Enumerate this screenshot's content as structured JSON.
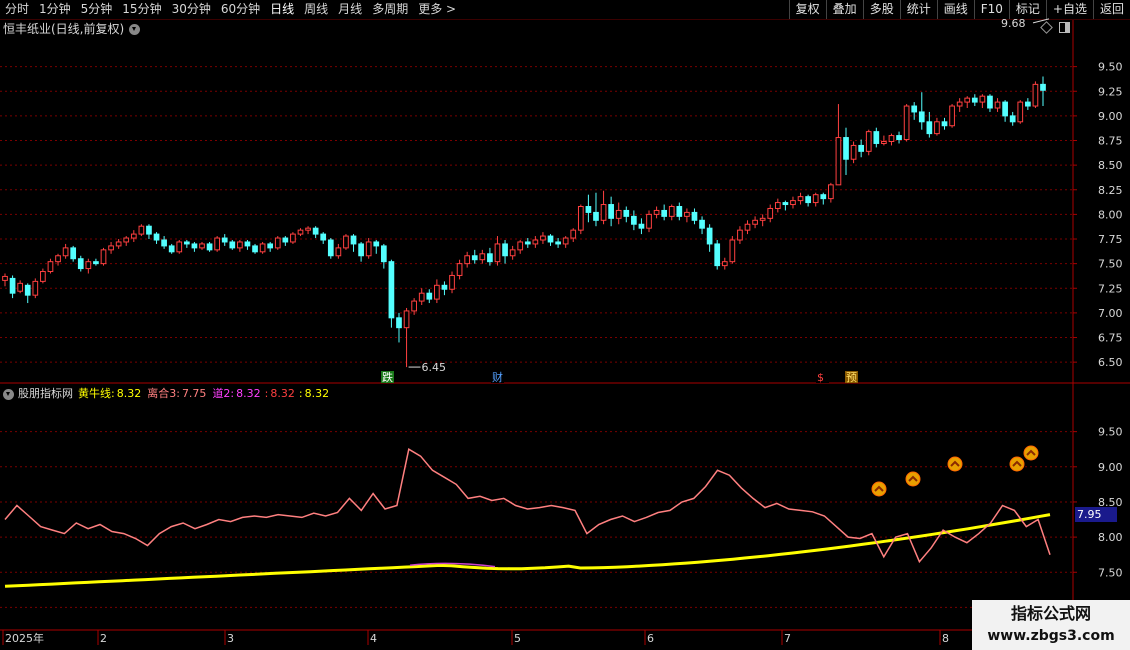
{
  "toolbar": {
    "periods": [
      "分时",
      "1分钟",
      "5分钟",
      "15分钟",
      "30分钟",
      "60分钟",
      "日线",
      "周线",
      "月线",
      "多周期",
      "更多 >"
    ],
    "active_period": "日线",
    "actions": [
      "复权",
      "叠加",
      "多股",
      "统计",
      "画线",
      "F10",
      "标记",
      "+自选",
      "返回"
    ]
  },
  "stock": {
    "title": "恒丰纸业(日线,前复权)",
    "high_label": "9.68",
    "low_label": "6.45"
  },
  "indicator": {
    "source": "股朋指标网",
    "l1_name": "黄牛线:",
    "l1_value": "8.32",
    "l2_name": "离合3:",
    "l2_value": "7.75",
    "l3_name": "道2:",
    "l3_value": "8.32",
    "l4_name": ":",
    "l4_value": "8.32",
    "l5_name": ":",
    "l5_value": "8.32",
    "current_badge": "7.95"
  },
  "markers": {
    "fall": "跌",
    "fin": "财",
    "dollar": "$",
    "pre": "预"
  },
  "axes": {
    "price_ticks": [
      "9.50",
      "9.25",
      "9.00",
      "8.75",
      "8.50",
      "8.25",
      "8.00",
      "7.75",
      "7.50",
      "7.25",
      "7.00",
      "6.75",
      "6.50"
    ],
    "ind_ticks": [
      "9.50",
      "9.00",
      "8.50",
      "8.00",
      "7.50",
      "7.00"
    ],
    "time_labels": [
      "2025年",
      "2",
      "3",
      "4",
      "5",
      "6",
      "7",
      "8"
    ]
  },
  "colors": {
    "up": "#ff4040",
    "down": "#54ffff",
    "yellow_line": "#ffff00",
    "pink_line": "#ff8080",
    "grid": "#7a0000"
  },
  "watermark": {
    "line1": "指标公式网",
    "line2": "www.zbgs3.com"
  },
  "chart_data": {
    "type": "candlestick",
    "title": "恒丰纸业(日线,前复权)",
    "price_range": [
      6.4,
      9.75
    ],
    "price_high": 9.68,
    "price_low": 6.45,
    "candles": [
      [
        7.33,
        7.37,
        7.27,
        7.4
      ],
      [
        7.35,
        7.2,
        7.15,
        7.38
      ],
      [
        7.22,
        7.3,
        7.2,
        7.33
      ],
      [
        7.28,
        7.18,
        7.1,
        7.3
      ],
      [
        7.18,
        7.32,
        7.15,
        7.35
      ],
      [
        7.32,
        7.42,
        7.3,
        7.45
      ],
      [
        7.42,
        7.52,
        7.4,
        7.55
      ],
      [
        7.52,
        7.58,
        7.48,
        7.6
      ],
      [
        7.58,
        7.66,
        7.55,
        7.7
      ],
      [
        7.66,
        7.55,
        7.52,
        7.68
      ],
      [
        7.55,
        7.45,
        7.42,
        7.58
      ],
      [
        7.45,
        7.52,
        7.4,
        7.55
      ],
      [
        7.52,
        7.5,
        7.48,
        7.55
      ],
      [
        7.5,
        7.64,
        7.48,
        7.66
      ],
      [
        7.64,
        7.68,
        7.6,
        7.72
      ],
      [
        7.68,
        7.72,
        7.65,
        7.75
      ],
      [
        7.72,
        7.76,
        7.68,
        7.78
      ],
      [
        7.76,
        7.8,
        7.72,
        7.84
      ],
      [
        7.8,
        7.88,
        7.78,
        7.9
      ],
      [
        7.88,
        7.8,
        7.75,
        7.9
      ],
      [
        7.8,
        7.74,
        7.7,
        7.82
      ],
      [
        7.74,
        7.68,
        7.65,
        7.78
      ],
      [
        7.68,
        7.62,
        7.6,
        7.7
      ],
      [
        7.62,
        7.72,
        7.6,
        7.74
      ],
      [
        7.72,
        7.7,
        7.66,
        7.74
      ],
      [
        7.7,
        7.66,
        7.62,
        7.72
      ],
      [
        7.66,
        7.7,
        7.64,
        7.72
      ],
      [
        7.7,
        7.64,
        7.62,
        7.72
      ],
      [
        7.64,
        7.76,
        7.62,
        7.78
      ],
      [
        7.76,
        7.72,
        7.68,
        7.8
      ],
      [
        7.72,
        7.66,
        7.64,
        7.74
      ],
      [
        7.66,
        7.72,
        7.62,
        7.74
      ],
      [
        7.72,
        7.68,
        7.64,
        7.74
      ],
      [
        7.68,
        7.62,
        7.6,
        7.7
      ],
      [
        7.62,
        7.7,
        7.6,
        7.72
      ],
      [
        7.7,
        7.66,
        7.62,
        7.72
      ],
      [
        7.66,
        7.76,
        7.64,
        7.78
      ],
      [
        7.76,
        7.72,
        7.68,
        7.78
      ],
      [
        7.72,
        7.8,
        7.7,
        7.82
      ],
      [
        7.8,
        7.84,
        7.78,
        7.86
      ],
      [
        7.84,
        7.86,
        7.8,
        7.88
      ],
      [
        7.86,
        7.8,
        7.76,
        7.88
      ],
      [
        7.8,
        7.74,
        7.7,
        7.82
      ],
      [
        7.74,
        7.58,
        7.55,
        7.76
      ],
      [
        7.58,
        7.66,
        7.55,
        7.7
      ],
      [
        7.66,
        7.78,
        7.64,
        7.8
      ],
      [
        7.78,
        7.7,
        7.62,
        7.8
      ],
      [
        7.7,
        7.58,
        7.52,
        7.72
      ],
      [
        7.58,
        7.72,
        7.55,
        7.76
      ],
      [
        7.72,
        7.68,
        7.6,
        7.74
      ],
      [
        7.68,
        7.52,
        7.45,
        7.7
      ],
      [
        7.52,
        6.95,
        6.85,
        7.54
      ],
      [
        6.95,
        6.85,
        6.7,
        7.0
      ],
      [
        6.85,
        7.02,
        6.45,
        7.05
      ],
      [
        7.02,
        7.12,
        6.98,
        7.15
      ],
      [
        7.12,
        7.2,
        7.08,
        7.25
      ],
      [
        7.2,
        7.14,
        7.1,
        7.24
      ],
      [
        7.14,
        7.28,
        7.1,
        7.34
      ],
      [
        7.28,
        7.24,
        7.18,
        7.32
      ],
      [
        7.24,
        7.38,
        7.2,
        7.42
      ],
      [
        7.38,
        7.5,
        7.34,
        7.54
      ],
      [
        7.5,
        7.58,
        7.46,
        7.62
      ],
      [
        7.58,
        7.54,
        7.5,
        7.64
      ],
      [
        7.54,
        7.6,
        7.5,
        7.64
      ],
      [
        7.6,
        7.52,
        7.48,
        7.66
      ],
      [
        7.52,
        7.7,
        7.48,
        7.78
      ],
      [
        7.7,
        7.58,
        7.5,
        7.74
      ],
      [
        7.58,
        7.64,
        7.54,
        7.68
      ],
      [
        7.64,
        7.72,
        7.6,
        7.74
      ],
      [
        7.72,
        7.7,
        7.66,
        7.76
      ],
      [
        7.7,
        7.74,
        7.66,
        7.78
      ],
      [
        7.74,
        7.78,
        7.7,
        7.82
      ],
      [
        7.78,
        7.72,
        7.68,
        7.8
      ],
      [
        7.72,
        7.7,
        7.66,
        7.76
      ],
      [
        7.7,
        7.76,
        7.66,
        7.78
      ],
      [
        7.76,
        7.84,
        7.72,
        7.86
      ],
      [
        7.84,
        8.08,
        7.8,
        8.1
      ],
      [
        8.08,
        8.02,
        7.92,
        8.2
      ],
      [
        8.02,
        7.94,
        7.88,
        8.22
      ],
      [
        7.94,
        8.1,
        7.9,
        8.24
      ],
      [
        8.1,
        7.96,
        7.88,
        8.18
      ],
      [
        7.96,
        8.04,
        7.9,
        8.12
      ],
      [
        8.04,
        7.98,
        7.92,
        8.08
      ],
      [
        7.98,
        7.9,
        7.84,
        8.04
      ],
      [
        7.9,
        7.86,
        7.8,
        7.96
      ],
      [
        7.86,
        8.0,
        7.82,
        8.04
      ],
      [
        8.0,
        8.04,
        7.96,
        8.08
      ],
      [
        8.04,
        7.98,
        7.94,
        8.1
      ],
      [
        7.98,
        8.08,
        7.94,
        8.1
      ],
      [
        8.08,
        7.98,
        7.94,
        8.12
      ],
      [
        7.98,
        8.02,
        7.92,
        8.06
      ],
      [
        8.02,
        7.94,
        7.9,
        8.06
      ],
      [
        7.94,
        7.86,
        7.8,
        7.98
      ],
      [
        7.86,
        7.7,
        7.62,
        7.9
      ],
      [
        7.7,
        7.48,
        7.44,
        7.74
      ],
      [
        7.48,
        7.52,
        7.44,
        7.56
      ],
      [
        7.52,
        7.74,
        7.5,
        7.78
      ],
      [
        7.74,
        7.84,
        7.7,
        7.88
      ],
      [
        7.84,
        7.9,
        7.8,
        7.94
      ],
      [
        7.9,
        7.94,
        7.86,
        7.98
      ],
      [
        7.94,
        7.96,
        7.88,
        8.0
      ],
      [
        7.96,
        8.06,
        7.92,
        8.1
      ],
      [
        8.06,
        8.12,
        8.02,
        8.16
      ],
      [
        8.12,
        8.1,
        8.04,
        8.14
      ],
      [
        8.1,
        8.14,
        8.06,
        8.18
      ],
      [
        8.14,
        8.18,
        8.1,
        8.22
      ],
      [
        8.18,
        8.12,
        8.08,
        8.2
      ],
      [
        8.12,
        8.2,
        8.08,
        8.22
      ],
      [
        8.2,
        8.16,
        8.1,
        8.22
      ],
      [
        8.16,
        8.3,
        8.12,
        8.32
      ],
      [
        8.3,
        8.78,
        8.45,
        9.12
      ],
      [
        8.78,
        8.56,
        8.4,
        8.88
      ],
      [
        8.56,
        8.7,
        8.52,
        8.74
      ],
      [
        8.7,
        8.64,
        8.58,
        8.76
      ],
      [
        8.64,
        8.84,
        8.6,
        8.86
      ],
      [
        8.84,
        8.72,
        8.68,
        8.88
      ],
      [
        8.72,
        8.74,
        8.7,
        8.8
      ],
      [
        8.74,
        8.8,
        8.7,
        8.82
      ],
      [
        8.8,
        8.76,
        8.72,
        8.84
      ],
      [
        8.76,
        9.1,
        8.74,
        9.12
      ],
      [
        9.1,
        9.04,
        8.96,
        9.14
      ],
      [
        9.04,
        8.94,
        8.86,
        9.24
      ],
      [
        8.94,
        8.82,
        8.78,
        9.04
      ],
      [
        8.82,
        8.94,
        8.8,
        8.98
      ],
      [
        8.94,
        8.9,
        8.86,
        8.98
      ],
      [
        8.9,
        9.1,
        8.88,
        9.12
      ],
      [
        9.1,
        9.14,
        9.04,
        9.18
      ],
      [
        9.14,
        9.18,
        9.08,
        9.2
      ],
      [
        9.18,
        9.14,
        9.1,
        9.22
      ],
      [
        9.14,
        9.2,
        9.08,
        9.22
      ],
      [
        9.2,
        9.08,
        9.04,
        9.22
      ],
      [
        9.08,
        9.14,
        9.04,
        9.18
      ],
      [
        9.14,
        9.0,
        8.94,
        9.16
      ],
      [
        9.0,
        8.94,
        8.9,
        9.04
      ],
      [
        8.94,
        9.14,
        8.92,
        9.16
      ],
      [
        9.14,
        9.1,
        9.06,
        9.18
      ],
      [
        9.1,
        9.32,
        9.08,
        9.35
      ],
      [
        9.32,
        9.26,
        9.1,
        9.4
      ]
    ],
    "pink_series": [
      8.25,
      8.45,
      8.3,
      8.15,
      8.1,
      8.05,
      8.2,
      8.12,
      8.18,
      8.08,
      8.05,
      7.98,
      7.88,
      8.05,
      8.15,
      8.2,
      8.12,
      8.18,
      8.25,
      8.22,
      8.28,
      8.3,
      8.28,
      8.32,
      8.3,
      8.28,
      8.34,
      8.3,
      8.35,
      8.55,
      8.38,
      8.62,
      8.4,
      8.45,
      9.25,
      9.15,
      8.95,
      8.85,
      8.75,
      8.55,
      8.58,
      8.52,
      8.55,
      8.45,
      8.4,
      8.42,
      8.45,
      8.42,
      8.38,
      8.05,
      8.18,
      8.25,
      8.3,
      8.22,
      8.28,
      8.35,
      8.38,
      8.5,
      8.55,
      8.72,
      8.95,
      8.88,
      8.7,
      8.55,
      8.42,
      8.48,
      8.4,
      8.38,
      8.36,
      8.3,
      8.15,
      8.0,
      7.98,
      8.05,
      7.72,
      8.0,
      8.05,
      7.65,
      7.85,
      8.1,
      8.0,
      7.92,
      8.05,
      8.2,
      8.45,
      8.38,
      8.15,
      8.25,
      7.75
    ],
    "yellow_series_start": 7.3,
    "yellow_series_end": 8.32,
    "signal_arrows_count": 5
  }
}
